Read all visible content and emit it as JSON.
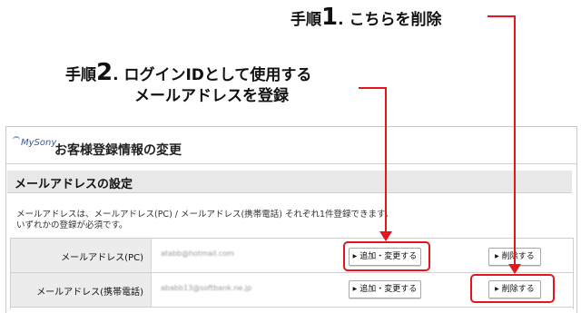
{
  "callouts": {
    "step1": {
      "prefix": "手順",
      "number": "1",
      "text": ". こちらを削除"
    },
    "step2": {
      "prefix": "手順",
      "number": "2",
      "text": ". ログインIDとして使用する",
      "line2": "メールアドレスを登録"
    }
  },
  "header": {
    "logo": "MySony",
    "title": "お客様登録情報の変更"
  },
  "section": {
    "heading": "メールアドレスの設定",
    "desc_line1": "メールアドレスは、メールアドレス(PC) / メールアドレス(携帯電話) それぞれ1件登録できます。",
    "desc_line2": "いずれかの登録が必須です。"
  },
  "table": {
    "rows": [
      {
        "label": "メールアドレス(PC)",
        "email": "atabb@hotmail.com",
        "add_label": "追加・変更する",
        "delete_label": "削除する"
      },
      {
        "label": "メールアドレス(携帯電話)",
        "email": "ababb13@softbank.ne.jp",
        "add_label": "追加・変更する",
        "delete_label": "削除する"
      }
    ]
  },
  "colors": {
    "highlight": "#e4151c",
    "section_bg": "#e8e8e8"
  },
  "icons": {
    "button_arrow": "triangle-right-icon"
  }
}
